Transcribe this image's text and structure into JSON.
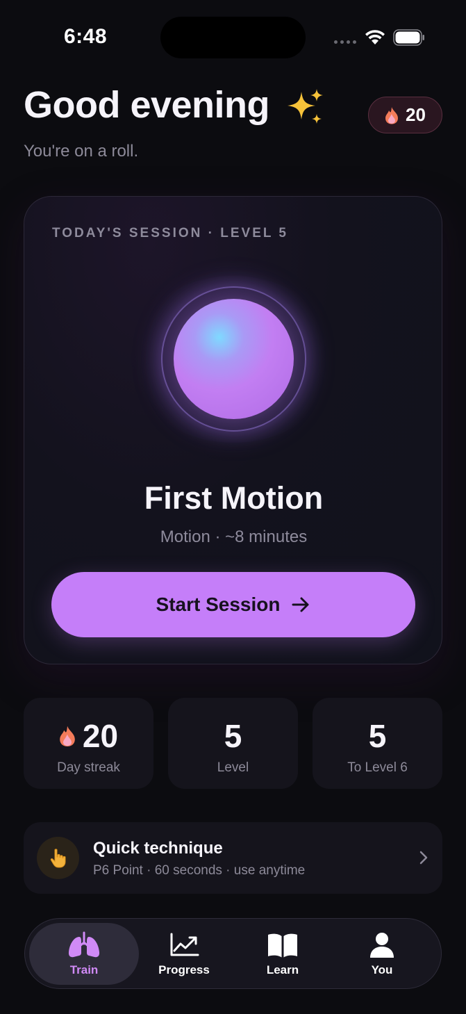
{
  "status_bar": {
    "time": "6:48"
  },
  "header": {
    "greeting": "Good evening",
    "subtitle": "You're on a roll.",
    "streak_count": "20",
    "icons": {
      "sparkle": "sparkles-icon",
      "flame": "flame-icon"
    }
  },
  "session": {
    "label": "TODAY'S SESSION · LEVEL 5",
    "title": "First Motion",
    "meta": "Motion · ~8 minutes",
    "button_label": "Start Session",
    "orb_color": "#c27ef2",
    "accent": "#c57ef9"
  },
  "stats": [
    {
      "value": "20",
      "label": "Day streak",
      "icon": "flame-icon"
    },
    {
      "value": "5",
      "label": "Level"
    },
    {
      "value": "5",
      "label": "To Level 6"
    }
  ],
  "quick_technique": {
    "title": "Quick technique",
    "subtitle": "P6 Point · 60 seconds · use anytime",
    "icon": "pointing-hand-icon"
  },
  "tabs": [
    {
      "label": "Train",
      "icon": "lungs-icon",
      "active": true
    },
    {
      "label": "Progress",
      "icon": "chart-trend-icon",
      "active": false
    },
    {
      "label": "Learn",
      "icon": "book-icon",
      "active": false
    },
    {
      "label": "You",
      "icon": "person-icon",
      "active": false
    }
  ],
  "colors": {
    "background": "#0c0c10",
    "card": "#15141c",
    "active_tab": "#d08af6",
    "streak_pill_bg": "#2a1620"
  }
}
